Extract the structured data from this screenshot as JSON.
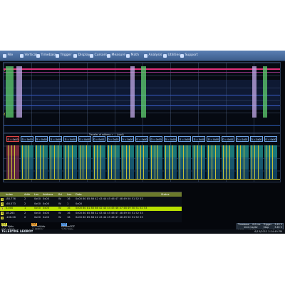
{
  "menu": {
    "items": [
      {
        "label": "File"
      },
      {
        "label": "Vertical"
      },
      {
        "label": "Timebase"
      },
      {
        "label": "Trigger"
      },
      {
        "label": "Display"
      },
      {
        "label": "Cursors"
      },
      {
        "label": "Measure"
      },
      {
        "label": "Math"
      },
      {
        "label": "Analysis"
      },
      {
        "label": "Utilities"
      },
      {
        "label": "Support"
      }
    ]
  },
  "decode": {
    "header": "Transfer of address = ... (cont)",
    "boxes": [
      "D = 0x00",
      "D = 0x00",
      "D = 0x00",
      "D = 0x00",
      "D = 0x00",
      "D = 0x00",
      "D = 0x00",
      "D = 0x00",
      "D = 0x00",
      "D = 0x00",
      "D = 0x00",
      "D = 0x00",
      "D = 0x00",
      "D = 0x00",
      "D = 0x00",
      "D = 0x00",
      "D = 0x00",
      "D = 0x00",
      "D = 0x00"
    ]
  },
  "table": {
    "headers": [
      "Index",
      "Addr",
      "Len",
      "Address",
      "Rd",
      "Len",
      "Data",
      "Status"
    ],
    "rows": [
      {
        "num": "1",
        "index": "-88.776",
        "addr": "2",
        "len": "0x00",
        "address": "0x00",
        "rd": "W",
        "dlen": "16",
        "data": "0x00 80 85 86 42 43 44 45 46 47 48 49 50 51 52 53",
        "status": ""
      },
      {
        "num": "2",
        "index": "-68.573",
        "addr": "2",
        "len": "0x00",
        "address": "0x00",
        "rd": "W",
        "dlen": "1",
        "data": "0x00",
        "status": ""
      },
      {
        "num": "3",
        "index": "0.000",
        "addr": "1",
        "len": "0x00",
        "address": "0x00",
        "rd": "W",
        "dlen": "16",
        "data": "0x00 80 81 85 86 42 43 44 45 46 47 48 49 50 51 52 53",
        "status": ""
      },
      {
        "num": "4",
        "index": "18.263",
        "addr": "2",
        "len": "0x00",
        "address": "0x00",
        "rd": "W",
        "dlen": "16",
        "data": "0x00 80 85 86 42 43 44 45 46 47 48 49 50 51 52 53",
        "status": ""
      },
      {
        "num": "5",
        "index": "-106.26",
        "addr": "2",
        "len": "0x00",
        "address": "0x00",
        "rd": "W",
        "dlen": "16",
        "data": "0x00 80 85 86 42 43 44 45 46 47 48 49 50 51 52 53",
        "status": ""
      }
    ]
  },
  "channels": [
    {
      "tag": "C1",
      "line1": "1.00 V/div",
      "line2": "120 mV/div",
      "line3": "-2.3189 V"
    },
    {
      "tag": "C2",
      "line1": "120 mV/div",
      "line2": "-2.4680 V",
      "line3": ""
    },
    {
      "tag": "C3",
      "line1": "streamCDT",
      "line2": "1.00 V/div",
      "line3": "500 ps/div"
    }
  ],
  "timebase": {
    "rows": [
      [
        "Timebase",
        "0.0 ms",
        "Trigger",
        "3.45 V"
      ],
      [
        "",
        "10.0 ms/div",
        "Stop",
        "3.45 V"
      ],
      [
        "1 MS",
        "10 MS/s",
        "Edge",
        "Positive"
      ]
    ]
  },
  "brand": "TELEDYNE LECROY",
  "brand_sub": "LECROY",
  "datetime": "6/13/2012 3:24:49 PM",
  "colors": {
    "menubar": "#4a6ea1",
    "trace_magenta": "#e0307a",
    "trace_blue": "#3e64d8",
    "pulse_green": "#5fcf6f",
    "pulse_lilac": "#c3a9e8",
    "decode_teal": "#1f8a8a",
    "decode_yellow": "#e6e040",
    "row_highlight": "#b8e000"
  }
}
